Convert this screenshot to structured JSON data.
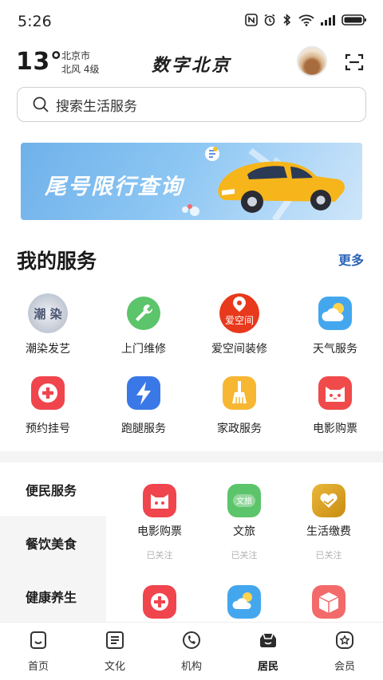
{
  "status_bar": {
    "time": "5:26"
  },
  "header": {
    "temperature": "13°",
    "city": "北京市",
    "wind": "北风  4级",
    "app_title": "数字北京"
  },
  "search": {
    "placeholder": "搜索生活服务"
  },
  "banner": {
    "text": "尾号限行查询"
  },
  "my_services": {
    "title": "我的服务",
    "more": "更多",
    "items": [
      {
        "label": "潮染发艺",
        "icon": "salon-photo-icon",
        "avatar_text": "潮 染"
      },
      {
        "label": "上门维修",
        "icon": "wrench-icon",
        "color": "#5cc46a"
      },
      {
        "label": "爱空间装修",
        "icon": "aikongjian-logo-icon",
        "color": "#e8391c",
        "logo_text": "爱空间"
      },
      {
        "label": "天气服务",
        "icon": "weather-icon",
        "color": "#44a7ee"
      },
      {
        "label": "预约挂号",
        "icon": "medical-cross-icon",
        "color": "#f0454d"
      },
      {
        "label": "跑腿服务",
        "icon": "lightning-icon",
        "color": "#3b78e7"
      },
      {
        "label": "家政服务",
        "icon": "broom-icon",
        "color": "#f7b733"
      },
      {
        "label": "电影购票",
        "icon": "movie-cat-icon",
        "color": "#f04a4a"
      }
    ]
  },
  "categories": {
    "items": [
      {
        "label": "便民服务",
        "active": true
      },
      {
        "label": "餐饮美食",
        "active": false
      },
      {
        "label": "健康养生",
        "active": false
      }
    ]
  },
  "sub_services": {
    "items": [
      {
        "label": "电影购票",
        "follow": "已关注",
        "icon": "movie-cat-icon",
        "color": "#f0454d"
      },
      {
        "label": "文旅",
        "follow": "已关注",
        "icon": "culture-tourism-icon",
        "color": "#5cc46a",
        "icon_text": "文旅"
      },
      {
        "label": "生活缴费",
        "follow": "已关注",
        "icon": "heart-hand-icon",
        "color": "#d9a21f"
      },
      {
        "label": "",
        "follow": "",
        "icon": "medical-cross-icon",
        "color": "#f0454d"
      },
      {
        "label": "",
        "follow": "",
        "icon": "weather-icon",
        "color": "#44a7ee"
      },
      {
        "label": "",
        "follow": "",
        "icon": "box-icon",
        "color": "#f26a6a"
      }
    ]
  },
  "bottom_nav": {
    "items": [
      {
        "label": "首页",
        "icon": "home-icon",
        "active": false
      },
      {
        "label": "文化",
        "icon": "culture-icon",
        "active": false
      },
      {
        "label": "机构",
        "icon": "institution-icon",
        "active": false
      },
      {
        "label": "居民",
        "icon": "resident-icon",
        "active": true
      },
      {
        "label": "会员",
        "icon": "member-icon",
        "active": false
      }
    ]
  }
}
